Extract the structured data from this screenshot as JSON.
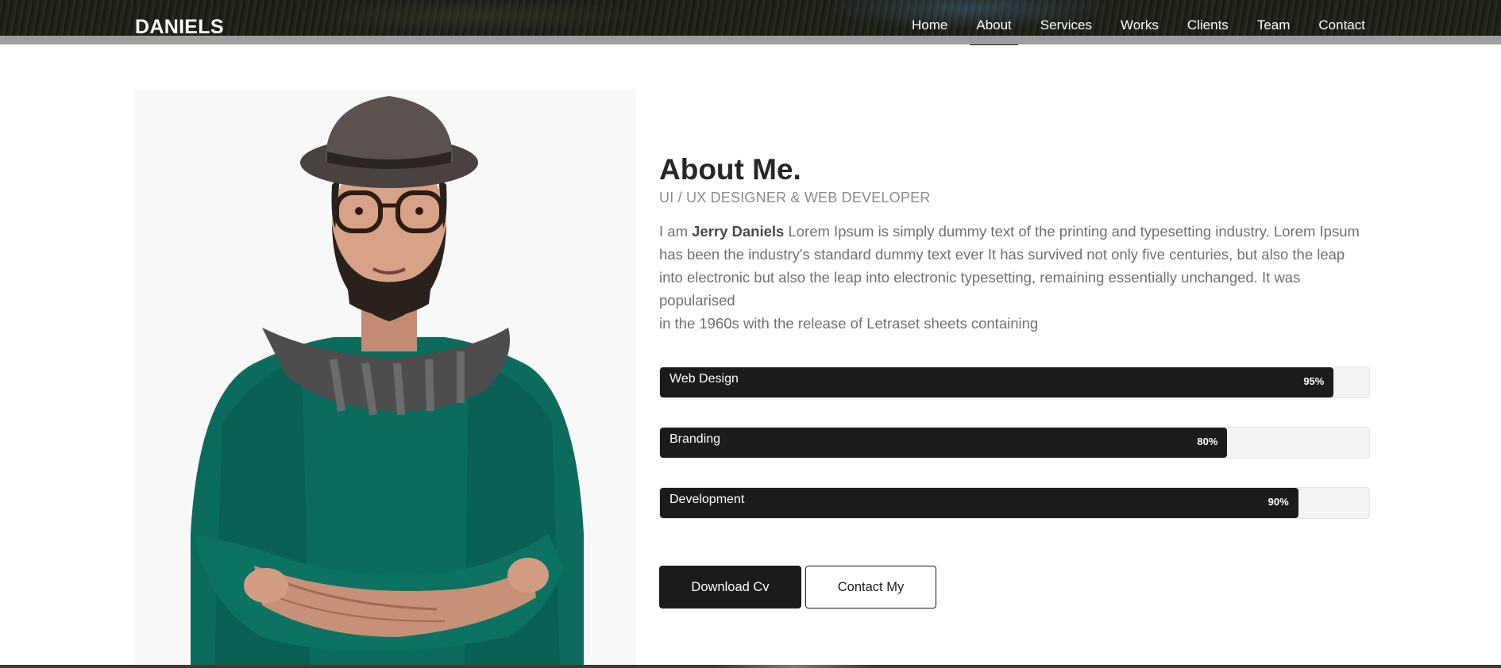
{
  "brand": "DANIELS",
  "nav": {
    "items": [
      {
        "label": "Home"
      },
      {
        "label": "About"
      },
      {
        "label": "Services"
      },
      {
        "label": "Works"
      },
      {
        "label": "Clients"
      },
      {
        "label": "Team"
      },
      {
        "label": "Contact"
      }
    ],
    "active": "About"
  },
  "about": {
    "title": "About Me.",
    "subtitle": "UI / UX DESIGNER & WEB DEVELOPER",
    "intro_prefix": "I am ",
    "name": "Jerry Daniels",
    "paragraph": " Lorem Ipsum is simply dummy text of the printing and typesetting industry. Lorem Ipsum has been the industry's standard dummy text ever It has survived not only five centuries, but also the leap into electronic but also the leap into electronic typesetting, remaining essentially unchanged. It was popularised",
    "paragraph_line2": "in the 1960s with the release of Letraset sheets containing"
  },
  "skills": [
    {
      "name": "Web Design",
      "percent": 95,
      "label": "95%"
    },
    {
      "name": "Branding",
      "percent": 80,
      "label": "80%"
    },
    {
      "name": "Development",
      "percent": 90,
      "label": "90%"
    }
  ],
  "buttons": {
    "download": "Download Cv",
    "contact": "Contact My"
  },
  "colors": {
    "accent": "#1b1b1b",
    "muted_text": "#707070",
    "sweater": "#0a6b5c"
  },
  "icons": {
    "portrait": "man-with-hat-portrait"
  }
}
